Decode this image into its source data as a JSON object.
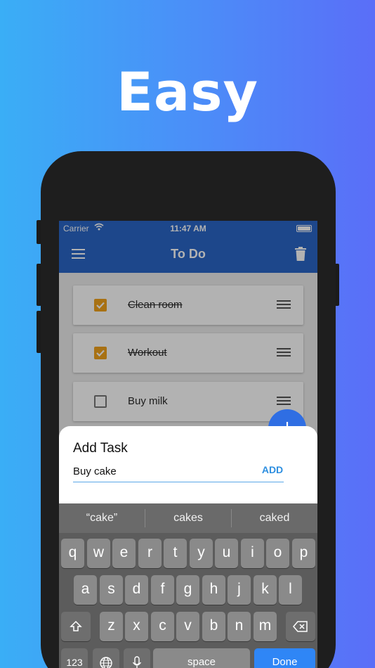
{
  "headline": "Easy",
  "status_bar": {
    "carrier": "Carrier",
    "time": "11:47 AM"
  },
  "app_bar": {
    "title": "To Do",
    "menu_icon": "menu-icon",
    "delete_icon": "trash-icon"
  },
  "tasks": [
    {
      "label": "Clean room",
      "done": true
    },
    {
      "label": "Workout",
      "done": true
    },
    {
      "label": "Buy milk",
      "done": false
    }
  ],
  "fab": {
    "icon": "plus-icon",
    "label": "+"
  },
  "add_task_sheet": {
    "title": "Add Task",
    "input_value": "Buy cake",
    "add_label": "ADD"
  },
  "keyboard": {
    "suggestions": [
      "“cake”",
      "cakes",
      "caked"
    ],
    "row1": [
      "q",
      "w",
      "e",
      "r",
      "t",
      "y",
      "u",
      "i",
      "o",
      "p"
    ],
    "row2": [
      "a",
      "s",
      "d",
      "f",
      "g",
      "h",
      "j",
      "k",
      "l"
    ],
    "row3": [
      "z",
      "x",
      "c",
      "v",
      "b",
      "n",
      "m"
    ],
    "numbers_key": "123",
    "space_key": "space",
    "done_key": "Done",
    "shift_icon": "shift-icon",
    "backspace_icon": "backspace-icon",
    "globe_icon": "globe-icon",
    "mic_icon": "microphone-icon"
  },
  "colors": {
    "app_bar": "#2a66c8",
    "checkbox": "#f1a21c",
    "accent": "#2e8fe0",
    "done_key": "#2f86f6"
  }
}
